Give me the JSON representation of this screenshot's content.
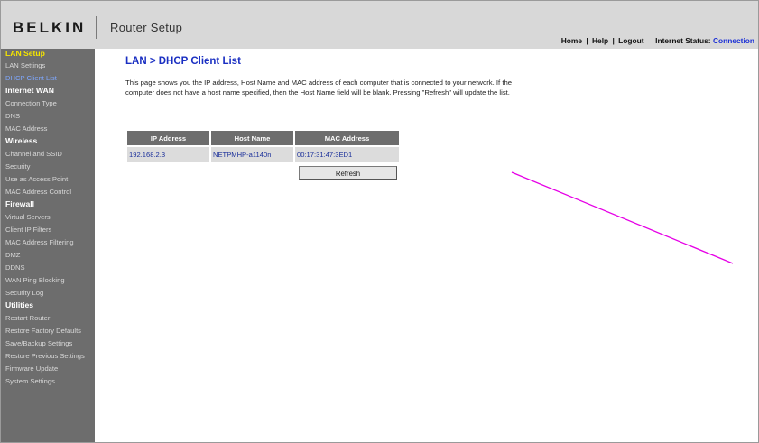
{
  "header": {
    "brand": "BELKIN",
    "app_title": "Router Setup",
    "nav": {
      "home": "Home",
      "help": "Help",
      "logout": "Logout",
      "sep": "|"
    },
    "status_label": "Internet Status:",
    "status_value": "Connection"
  },
  "sidebar": {
    "sections": [
      {
        "title": "LAN Setup",
        "active": true,
        "items": [
          "LAN Settings",
          "DHCP Client List"
        ],
        "active_item": 1
      },
      {
        "title": "Internet WAN",
        "items": [
          "Connection Type",
          "DNS",
          "MAC Address"
        ]
      },
      {
        "title": "Wireless",
        "items": [
          "Channel and SSID",
          "Security",
          "Use as Access Point",
          "MAC Address Control"
        ]
      },
      {
        "title": "Firewall",
        "items": [
          "Virtual Servers",
          "Client IP Filters",
          "MAC Address Filtering",
          "DMZ",
          "DDNS",
          "WAN Ping Blocking",
          "Security Log"
        ]
      },
      {
        "title": "Utilities",
        "items": [
          "Restart Router",
          "Restore Factory Defaults",
          "Save/Backup Settings",
          "Restore Previous Settings",
          "Firmware Update",
          "System Settings"
        ]
      }
    ]
  },
  "main": {
    "title": "LAN > DHCP Client List",
    "description": "This page shows you the IP address, Host Name and MAC address of each computer that is connected to your network. If the computer does not have a host name specified, then the Host Name field will be blank. Pressing \"Refresh\" will update the list.",
    "table": {
      "headers": [
        "IP Address",
        "Host Name",
        "MAC Address"
      ],
      "rows": [
        [
          "192.168.2.3",
          "NETPMHP-a1140n",
          "00:17:31:47:3ED1"
        ]
      ]
    },
    "refresh_label": "Refresh"
  },
  "colors": {
    "accent_title": "#1a2fc2",
    "sidebar_bg": "#6d6d6d",
    "active_section": "#f5e500",
    "active_item": "#7fa8ff",
    "annotation_line": "#e600e6"
  }
}
